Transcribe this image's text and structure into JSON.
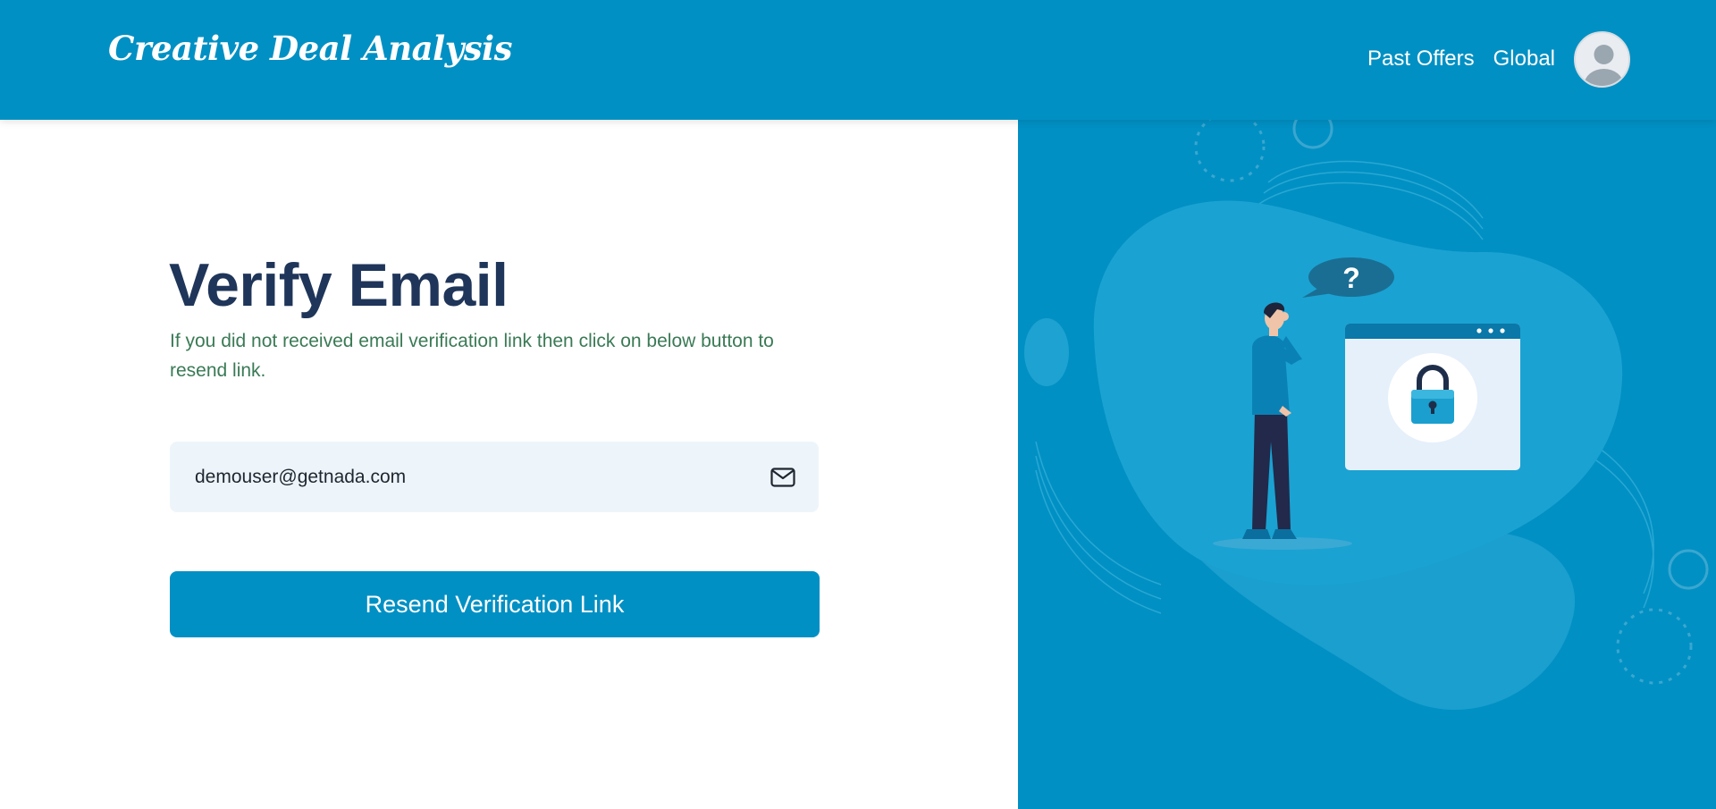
{
  "app": {
    "brand": "Creative Deal Analysis"
  },
  "nav": {
    "items": [
      {
        "label": "Past Offers"
      },
      {
        "label": "Global"
      }
    ]
  },
  "form": {
    "title": "Verify Email",
    "subtitle": "If you did not received email verification link then click on below button to resend link.",
    "email_value": "demouser@getnada.com",
    "email_icon": "envelope-icon",
    "button_label": "Resend Verification Link"
  },
  "illustration": {
    "bubble_text": "?",
    "icons": [
      "question-bubble-icon",
      "lock-icon",
      "user-avatar-icon"
    ]
  },
  "colors": {
    "primary": "#0190c4",
    "title": "#1f3559",
    "subtitle": "#3a7a55",
    "field_bg": "#eef5fa"
  }
}
